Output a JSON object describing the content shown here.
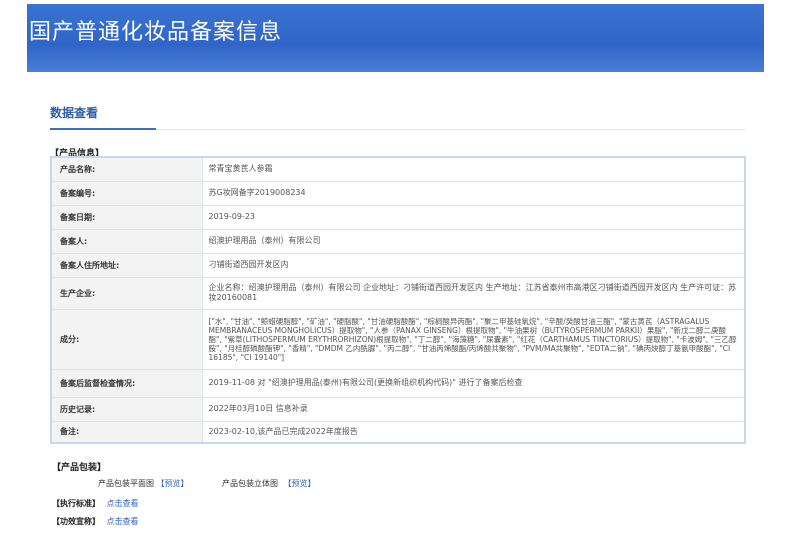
{
  "banner": {
    "title": "国产普通化妆品备案信息"
  },
  "tab": {
    "label": "数据查看"
  },
  "product_info": {
    "section_title": "【产品信息】",
    "rows": [
      {
        "key": "产品名称:",
        "value": "常青宝黄芪人参霜"
      },
      {
        "key": "备案编号:",
        "value": "苏G妆网备字2019008234"
      },
      {
        "key": "备案日期:",
        "value": "2019-09-23"
      },
      {
        "key": "备案人:",
        "value": "绍澳护理用品（泰州）有限公司"
      },
      {
        "key": "备案人住所地址:",
        "value": "刁铺街道西园开发区内"
      },
      {
        "key": "生产企业:",
        "value": "企业名称：绍澳护理用品（泰州）有限公司 企业地址：刁铺街道西园开发区内 生产地址：江苏省泰州市高港区刁铺街道西园开发区内 生产许可证：苏妆20160081"
      },
      {
        "key": "成分:",
        "value": "[\"水\", \"甘油\", \"鲸蜡硬脂醇\", \"矿油\", \"硬脂酸\", \"甘油硬脂酸酯\", \"棕榈酸异丙酯\", \"聚二甲基硅氧烷\", \"辛酸/癸酸甘油三酯\", \"蒙古黄芪（ASTRAGALUS MEMBRANACEUS MONGHOLICUS）提取物\", \"人参（PANAX GINSENG）根提取物\", \"牛油果树（BUTYROSPERMUM PARKII）果脂\", \"新戊二醇二庚酸酯\", \"紫草(LITHOSPERMUM ERYTHRORHIZON)根提取物\", \"丁二醇\", \"海藻糖\", \"尿囊素\", \"红花（CARTHAMUS TINCTORIUS）提取物\", \"卡波姆\", \"三乙醇胺\", \"月桂醇磷酸酯钾\", \"香精\", \"DMDM 乙内酰脲\", \"丙二醇\", \"甘油丙烯酸酯/丙烯酸共聚物\", \"PVM/MA共聚物\", \"EDTA二钠\", \"碘丙炔醇丁基氨甲酸酯\", \"CI 16185\", \"CI 19140\"]"
      },
      {
        "key": "备案后监督检查情况:",
        "value": "2019-11-08 对 \"绍澳护理用品(泰州)有限公司(更换新组织机构代码)\" 进行了备案后检查"
      },
      {
        "key": "历史记录:",
        "value": "2022年03月10日 信息补录"
      },
      {
        "key": "备注:",
        "value": "2023-02-10,该产品已完成2022年度报告"
      }
    ]
  },
  "packaging": {
    "section_title": "【产品包装】",
    "flat_label": "产品包装平面图",
    "flat_link": "【预览】",
    "solid_label": "产品包装立体图",
    "solid_link": "【预览】"
  },
  "standard": {
    "section_title": "【执行标准】",
    "link": "点击查看"
  },
  "efficacy": {
    "section_title": "【功效宣称】",
    "link": "点击查看"
  }
}
